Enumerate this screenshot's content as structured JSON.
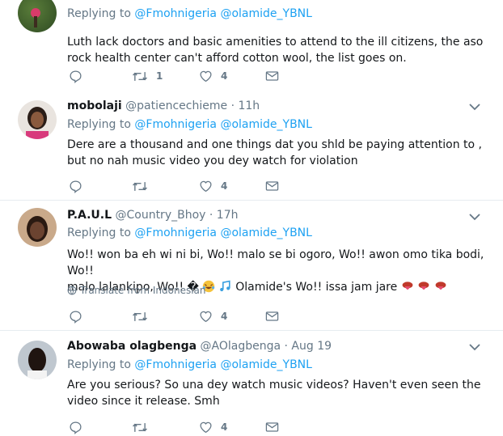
{
  "reply_prefix": "Replying to",
  "tweets": [
    {
      "name": "",
      "handle": "",
      "time": "",
      "mentions": [
        "@Fmohnigeria",
        "@olamide_YBNL"
      ],
      "text": "Luth lack doctors and basic amenities to attend to the ill citizens, the aso rock health center can't afford cotton wool, the list goes on.",
      "retweets": "1",
      "likes": "4"
    },
    {
      "name": "mobolaji",
      "handle": "@patiencechieme",
      "time": "11h",
      "mentions": [
        "@Fmohnigeria",
        "@olamide_YBNL"
      ],
      "text": "Dere are a thousand and one things dat you shld be paying attention to , but no nah music video you dey watch for violation",
      "retweets": "",
      "likes": "4"
    },
    {
      "name": "P.A.U.L",
      "handle": "@Country_Bhoy",
      "time": "17h",
      "mentions": [
        "@Fmohnigeria",
        "@olamide_YBNL"
      ],
      "text_line1": "Wo!! won ba eh wi ni bi, Wo!! malo se bi ogoro, Wo!! awon omo tika bodi, Wo!!",
      "text_line2a": "malo lalankipo, Wo!! �",
      "text_line2b": "Olamide's Wo!! issa jam jare",
      "translate": "Translate from Indonesian",
      "retweets": "",
      "likes": "4"
    },
    {
      "name": "Abowaba olagbenga",
      "handle": "@AOlagbenga",
      "time": "Aug 19",
      "mentions": [
        "@Fmohnigeria",
        "@olamide_YBNL"
      ],
      "text": "Are you serious? So una dey watch music videos? Haven't even seen the video since it release. Smh",
      "retweets": "",
      "likes": "4"
    }
  ],
  "separator": "·",
  "colors": {
    "link": "#1da1f2",
    "muted": "#657786",
    "border": "#e6ecf0",
    "text": "#14171a",
    "tongue": "#c0392b"
  }
}
